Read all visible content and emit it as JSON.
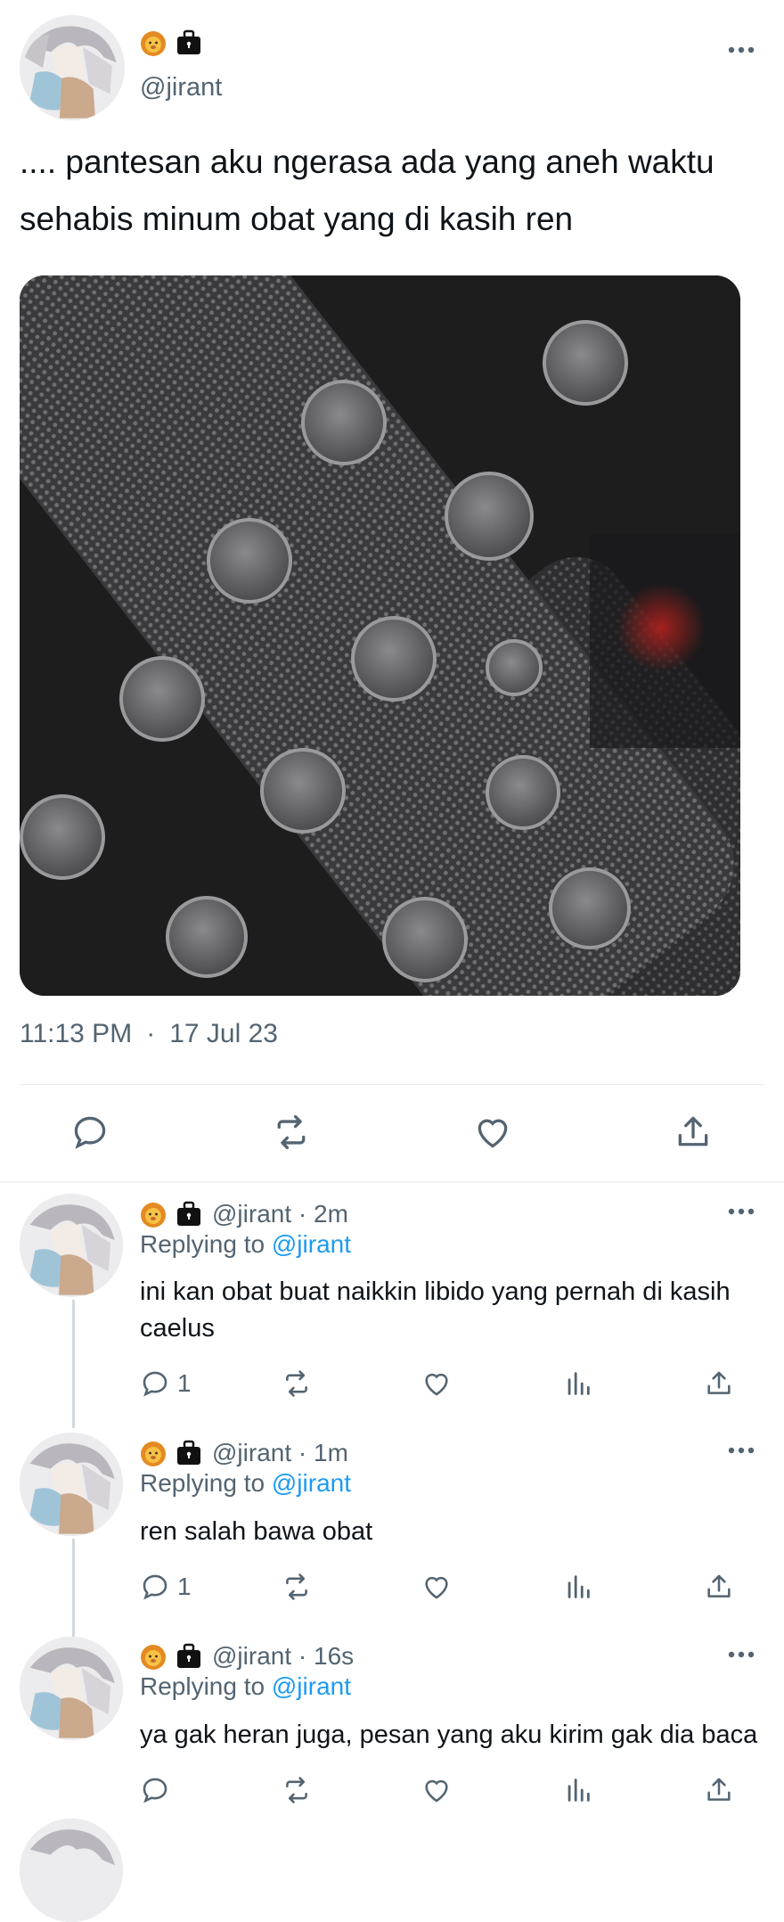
{
  "main_tweet": {
    "handle": "@jirant",
    "text": ".... pantesan aku ngerasa ada yang aneh waktu sehabis minum obat yang di kasih ren",
    "time": "11:13 PM",
    "separator": "·",
    "date": "17 Jul 23",
    "badge_icons": [
      "lion-emoji-icon",
      "briefcase-icon"
    ],
    "photo_icon": "pill-blister-photo"
  },
  "replies": [
    {
      "handle": "@jirant",
      "age": "2m",
      "replying_prefix": "Replying to",
      "replying_to": "@jirant",
      "text": "ini kan obat buat naikkin libido yang pernah di kasih caelus",
      "reply_count": "1"
    },
    {
      "handle": "@jirant",
      "age": "1m",
      "replying_prefix": "Replying to",
      "replying_to": "@jirant",
      "text": "ren salah bawa obat",
      "reply_count": "1"
    },
    {
      "handle": "@jirant",
      "age": "16s",
      "replying_prefix": "Replying to",
      "replying_to": "@jirant",
      "text": "ya gak heran juga, pesan yang aku kirim gak dia baca",
      "reply_count": ""
    }
  ],
  "header_sep": "·",
  "colors": {
    "text": "#0f1419",
    "secondary": "#536471",
    "accent": "#1d9bf0",
    "divider": "#e5e7ea"
  }
}
